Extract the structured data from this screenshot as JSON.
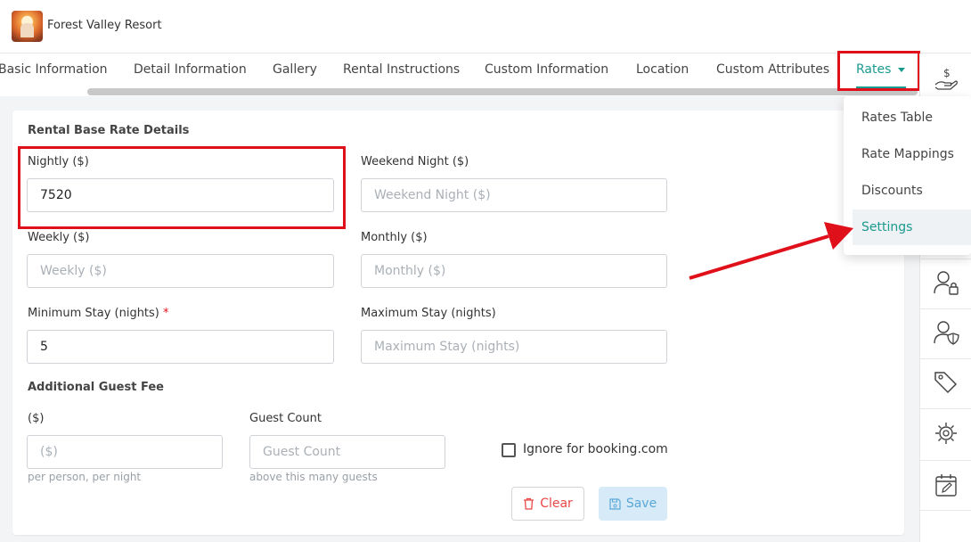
{
  "header": {
    "resort_name": "Forest Valley Resort"
  },
  "tabs": [
    {
      "label": "Basic Information"
    },
    {
      "label": "Detail Information"
    },
    {
      "label": "Gallery"
    },
    {
      "label": "Rental Instructions"
    },
    {
      "label": "Custom Information"
    },
    {
      "label": "Location"
    },
    {
      "label": "Custom Attributes"
    },
    {
      "label": "Rates"
    }
  ],
  "rates_menu": {
    "items": [
      {
        "label": "Rates Table"
      },
      {
        "label": "Rate Mappings"
      },
      {
        "label": "Discounts"
      },
      {
        "label": "Settings"
      }
    ],
    "selected": "Settings"
  },
  "form": {
    "section_title": "Rental Base Rate Details",
    "nightly": {
      "label": "Nightly ($)",
      "value": "7520"
    },
    "weekend_night": {
      "label": "Weekend Night ($)",
      "placeholder": "Weekend Night ($)"
    },
    "weekly": {
      "label": "Weekly ($)",
      "placeholder": "Weekly ($)"
    },
    "monthly": {
      "label": "Monthly ($)",
      "placeholder": "Monthly ($)"
    },
    "min_stay": {
      "label": "Minimum Stay (nights)",
      "required_mark": "*",
      "value": "5"
    },
    "max_stay": {
      "label": "Maximum Stay (nights)",
      "placeholder": "Maximum Stay (nights)"
    },
    "guest_fee_title": "Additional Guest Fee",
    "fee": {
      "label": "($)",
      "placeholder": "($)",
      "hint": "per person, per night"
    },
    "guest_count": {
      "label": "Guest Count",
      "placeholder": "Guest Count",
      "hint": "above this many guests"
    },
    "ignore_booking": {
      "label": "Ignore for booking.com",
      "checked": false
    },
    "clear_label": "Clear",
    "save_label": "Save"
  },
  "rail_icons": [
    "dollar-hand-icon",
    "user-lock-icon",
    "user-shield-icon",
    "tags-icon",
    "gear-cog-icon",
    "calendar-edit-icon"
  ],
  "colors": {
    "accent": "#1a9a8e",
    "annotation": "#e0101b",
    "save_bg": "#d6ebf7"
  }
}
